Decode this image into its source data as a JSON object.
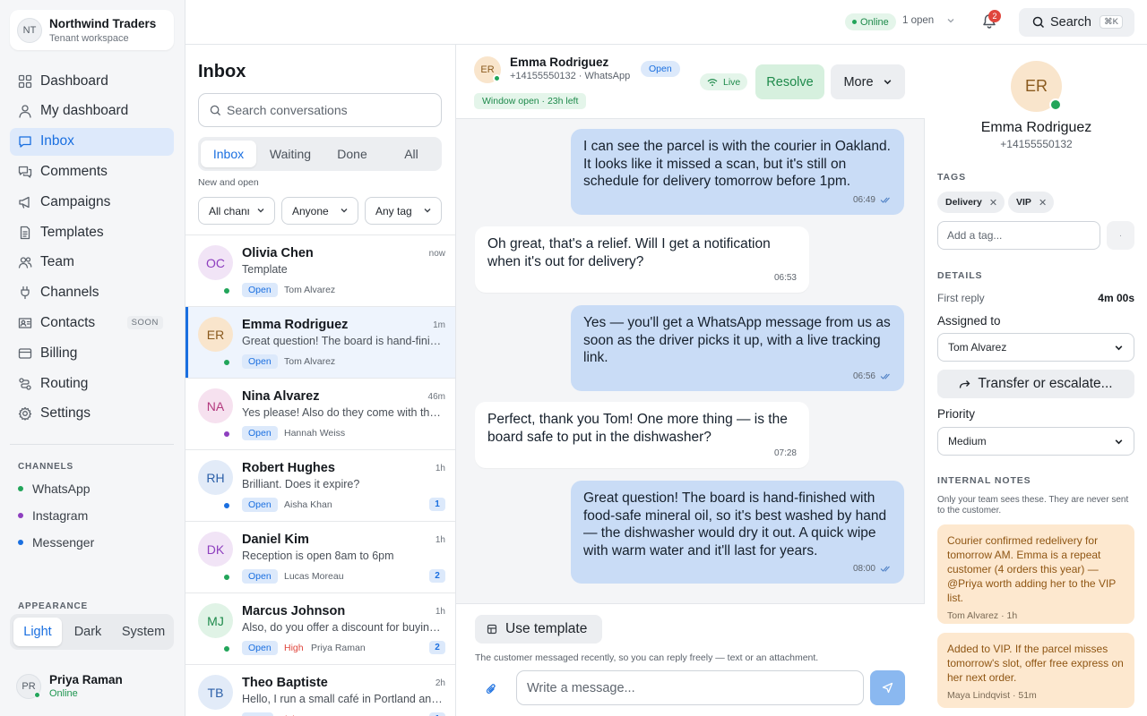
{
  "workspace": {
    "initials": "NT",
    "name": "Northwind Traders",
    "subtitle": "Tenant workspace"
  },
  "nav": [
    {
      "label": "Dashboard",
      "icon": "dashboard-icon"
    },
    {
      "label": "My dashboard",
      "icon": "user-icon"
    },
    {
      "label": "Inbox",
      "icon": "chat-icon",
      "active": true
    },
    {
      "label": "Comments",
      "icon": "comments-icon"
    },
    {
      "label": "Campaigns",
      "icon": "megaphone-icon"
    },
    {
      "label": "Templates",
      "icon": "document-icon"
    },
    {
      "label": "Team",
      "icon": "team-icon"
    },
    {
      "label": "Channels",
      "icon": "plug-icon"
    },
    {
      "label": "Contacts",
      "icon": "contacts-icon",
      "badge": "SOON"
    },
    {
      "label": "Billing",
      "icon": "card-icon"
    },
    {
      "label": "Routing",
      "icon": "routing-icon"
    },
    {
      "label": "Settings",
      "icon": "gear-icon"
    }
  ],
  "channels": {
    "heading": "CHANNELS",
    "items": [
      {
        "label": "WhatsApp",
        "color": "#22a55a"
      },
      {
        "label": "Instagram",
        "color": "#8e3fbf"
      },
      {
        "label": "Messenger",
        "color": "#1a6fe0"
      }
    ]
  },
  "appearance": {
    "heading": "APPEARANCE",
    "options": [
      "Light",
      "Dark",
      "System"
    ],
    "selected": "Light"
  },
  "user": {
    "initials": "PR",
    "name": "Priya Raman",
    "status": "Online"
  },
  "topbar": {
    "status": "Online",
    "open_count": "1 open",
    "notifications": "2",
    "search_label": "Search",
    "shortcut": "⌘K"
  },
  "inbox": {
    "title": "Inbox",
    "search_placeholder": "Search conversations",
    "tabs": [
      "Inbox",
      "Waiting",
      "Done",
      "All"
    ],
    "active_tab": "Inbox",
    "hint": "New and open",
    "filters": [
      "All channels",
      "Anyone",
      "Any tag"
    ],
    "conversations": [
      {
        "initials": "OC",
        "name": "Olivia Chen",
        "time": "now",
        "preview": "Template",
        "status": "Open",
        "agent": "Tom Alvarez",
        "channel_color": "#22a55a",
        "avatar_bg": "#f1e4f6",
        "avatar_fg": "#8e3fbf"
      },
      {
        "initials": "ER",
        "name": "Emma Rodriguez",
        "time": "1m",
        "preview": "Great question! The board is hand-finished with food-safe mineral oil",
        "status": "Open",
        "agent": "Tom Alvarez",
        "channel_color": "#22a55a",
        "avatar_bg": "#f9e5cc",
        "avatar_fg": "#8a5a1e",
        "selected": true
      },
      {
        "initials": "NA",
        "name": "Nina Alvarez",
        "time": "46m",
        "preview": "Yes please! Also do they come with the gift box?",
        "status": "Open",
        "agent": "Hannah Weiss",
        "channel_color": "#8e3fbf",
        "avatar_bg": "#f6e1ef",
        "avatar_fg": "#b3397e"
      },
      {
        "initials": "RH",
        "name": "Robert Hughes",
        "time": "1h",
        "preview": "Brilliant. Does it expire?",
        "status": "Open",
        "agent": "Aisha Khan",
        "channel_color": "#1a6fe0",
        "unread": "1",
        "avatar_bg": "#e2ebf8",
        "avatar_fg": "#2b5fa8"
      },
      {
        "initials": "DK",
        "name": "Daniel Kim",
        "time": "1h",
        "preview": "Reception is open 8am to 6pm",
        "status": "Open",
        "agent": "Lucas Moreau",
        "channel_color": "#22a55a",
        "unread": "2",
        "avatar_bg": "#f1e4f6",
        "avatar_fg": "#8e3fbf"
      },
      {
        "initials": "MJ",
        "name": "Marcus Johnson",
        "time": "1h",
        "preview": "Also, do you offer a discount for buying in bulk?",
        "status": "Open",
        "priority": "High",
        "agent": "Priya Raman",
        "channel_color": "#22a55a",
        "unread": "2",
        "avatar_bg": "#e0f3e6",
        "avatar_fg": "#1e8a4b"
      },
      {
        "initials": "TB",
        "name": "Theo Baptiste",
        "time": "2h",
        "preview": "Hello, I run a small café in Portland and I'd like to order",
        "status": "New",
        "priority": "High",
        "agent": "",
        "channel_color": "#22a55a",
        "unread": "1",
        "avatar_bg": "#e2ebf8",
        "avatar_fg": "#2b5fa8"
      }
    ]
  },
  "chat": {
    "contact_initials": "ER",
    "contact_name": "Emma Rodriguez",
    "contact_sub": "+14155550132 · WhatsApp",
    "status": "Open",
    "window": "Window open · 23h left",
    "live": "Live",
    "resolve_label": "Resolve",
    "more_label": "More",
    "messages": [
      {
        "dir": "out",
        "text": "I can see the parcel is with the courier in Oakland. It looks like it missed a scan, but it's still on schedule for delivery tomorrow before 1pm.",
        "time": "06:49"
      },
      {
        "dir": "in",
        "text": "Oh great, that's a relief. Will I get a notification when it's out for delivery?",
        "time": "06:53"
      },
      {
        "dir": "out",
        "text": "Yes — you'll get a WhatsApp message from us as soon as the driver picks it up, with a live tracking link.",
        "time": "06:56"
      },
      {
        "dir": "in",
        "text": "Perfect, thank you Tom! One more thing — is the board safe to put in the dishwasher?",
        "time": "07:28"
      },
      {
        "dir": "out",
        "text": "Great question! The board is hand-finished with food-safe mineral oil, so it's best washed by hand — the dishwasher would dry it out. A quick wipe with warm water and it'll last for years.",
        "time": "08:00"
      }
    ],
    "template_label": "Use template",
    "composer_hint": "The customer messaged recently, so you can reply freely — text or an attachment.",
    "input_placeholder": "Write a message..."
  },
  "details": {
    "initials": "ER",
    "name": "Emma Rodriguez",
    "phone": "+14155550132",
    "tags_heading": "TAGS",
    "tags": [
      "Delivery",
      "VIP"
    ],
    "tag_placeholder": "Add a tag...",
    "details_heading": "DETAILS",
    "first_reply_label": "First reply",
    "first_reply_value": "4m 00s",
    "assigned_label": "Assigned to",
    "assigned_value": "Tom Alvarez",
    "transfer_label": "Transfer or escalate...",
    "priority_label": "Priority",
    "priority_value": "Medium",
    "notes_heading": "INTERNAL NOTES",
    "notes_hint": "Only your team sees these. They are never sent to the customer.",
    "notes": [
      {
        "text": "Courier confirmed redelivery for tomorrow AM. Emma is a repeat customer (4 orders this year) — @Priya worth adding her to the VIP list.",
        "meta": "Tom Alvarez · 1h"
      },
      {
        "text": "Added to VIP. If the parcel misses tomorrow's slot, offer free express on her next order.",
        "meta": "Maya Lindqvist · 51m"
      }
    ]
  }
}
